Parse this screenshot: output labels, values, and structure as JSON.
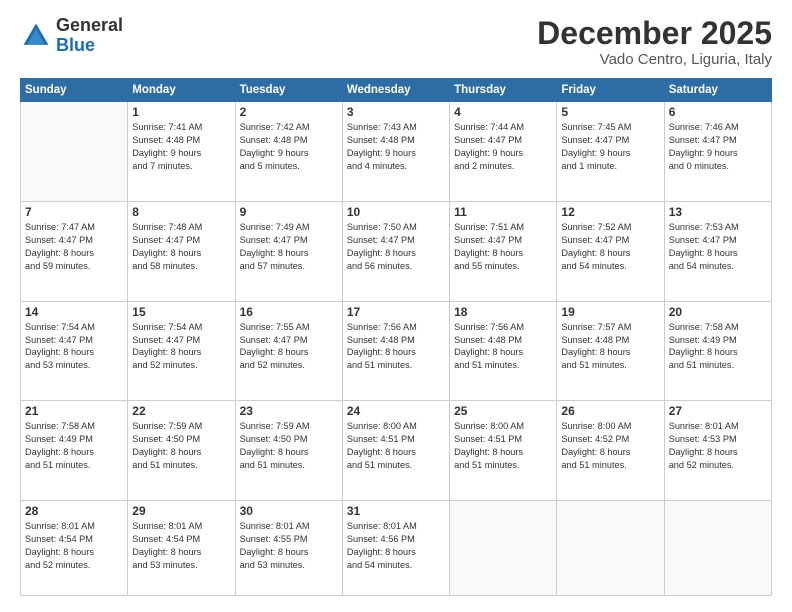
{
  "header": {
    "logo_general": "General",
    "logo_blue": "Blue",
    "month_title": "December 2025",
    "location": "Vado Centro, Liguria, Italy"
  },
  "weekdays": [
    "Sunday",
    "Monday",
    "Tuesday",
    "Wednesday",
    "Thursday",
    "Friday",
    "Saturday"
  ],
  "weeks": [
    [
      {
        "day": "",
        "info": ""
      },
      {
        "day": "1",
        "info": "Sunrise: 7:41 AM\nSunset: 4:48 PM\nDaylight: 9 hours\nand 7 minutes."
      },
      {
        "day": "2",
        "info": "Sunrise: 7:42 AM\nSunset: 4:48 PM\nDaylight: 9 hours\nand 5 minutes."
      },
      {
        "day": "3",
        "info": "Sunrise: 7:43 AM\nSunset: 4:48 PM\nDaylight: 9 hours\nand 4 minutes."
      },
      {
        "day": "4",
        "info": "Sunrise: 7:44 AM\nSunset: 4:47 PM\nDaylight: 9 hours\nand 2 minutes."
      },
      {
        "day": "5",
        "info": "Sunrise: 7:45 AM\nSunset: 4:47 PM\nDaylight: 9 hours\nand 1 minute."
      },
      {
        "day": "6",
        "info": "Sunrise: 7:46 AM\nSunset: 4:47 PM\nDaylight: 9 hours\nand 0 minutes."
      }
    ],
    [
      {
        "day": "7",
        "info": "Sunrise: 7:47 AM\nSunset: 4:47 PM\nDaylight: 8 hours\nand 59 minutes."
      },
      {
        "day": "8",
        "info": "Sunrise: 7:48 AM\nSunset: 4:47 PM\nDaylight: 8 hours\nand 58 minutes."
      },
      {
        "day": "9",
        "info": "Sunrise: 7:49 AM\nSunset: 4:47 PM\nDaylight: 8 hours\nand 57 minutes."
      },
      {
        "day": "10",
        "info": "Sunrise: 7:50 AM\nSunset: 4:47 PM\nDaylight: 8 hours\nand 56 minutes."
      },
      {
        "day": "11",
        "info": "Sunrise: 7:51 AM\nSunset: 4:47 PM\nDaylight: 8 hours\nand 55 minutes."
      },
      {
        "day": "12",
        "info": "Sunrise: 7:52 AM\nSunset: 4:47 PM\nDaylight: 8 hours\nand 54 minutes."
      },
      {
        "day": "13",
        "info": "Sunrise: 7:53 AM\nSunset: 4:47 PM\nDaylight: 8 hours\nand 54 minutes."
      }
    ],
    [
      {
        "day": "14",
        "info": "Sunrise: 7:54 AM\nSunset: 4:47 PM\nDaylight: 8 hours\nand 53 minutes."
      },
      {
        "day": "15",
        "info": "Sunrise: 7:54 AM\nSunset: 4:47 PM\nDaylight: 8 hours\nand 52 minutes."
      },
      {
        "day": "16",
        "info": "Sunrise: 7:55 AM\nSunset: 4:47 PM\nDaylight: 8 hours\nand 52 minutes."
      },
      {
        "day": "17",
        "info": "Sunrise: 7:56 AM\nSunset: 4:48 PM\nDaylight: 8 hours\nand 51 minutes."
      },
      {
        "day": "18",
        "info": "Sunrise: 7:56 AM\nSunset: 4:48 PM\nDaylight: 8 hours\nand 51 minutes."
      },
      {
        "day": "19",
        "info": "Sunrise: 7:57 AM\nSunset: 4:48 PM\nDaylight: 8 hours\nand 51 minutes."
      },
      {
        "day": "20",
        "info": "Sunrise: 7:58 AM\nSunset: 4:49 PM\nDaylight: 8 hours\nand 51 minutes."
      }
    ],
    [
      {
        "day": "21",
        "info": "Sunrise: 7:58 AM\nSunset: 4:49 PM\nDaylight: 8 hours\nand 51 minutes."
      },
      {
        "day": "22",
        "info": "Sunrise: 7:59 AM\nSunset: 4:50 PM\nDaylight: 8 hours\nand 51 minutes."
      },
      {
        "day": "23",
        "info": "Sunrise: 7:59 AM\nSunset: 4:50 PM\nDaylight: 8 hours\nand 51 minutes."
      },
      {
        "day": "24",
        "info": "Sunrise: 8:00 AM\nSunset: 4:51 PM\nDaylight: 8 hours\nand 51 minutes."
      },
      {
        "day": "25",
        "info": "Sunrise: 8:00 AM\nSunset: 4:51 PM\nDaylight: 8 hours\nand 51 minutes."
      },
      {
        "day": "26",
        "info": "Sunrise: 8:00 AM\nSunset: 4:52 PM\nDaylight: 8 hours\nand 51 minutes."
      },
      {
        "day": "27",
        "info": "Sunrise: 8:01 AM\nSunset: 4:53 PM\nDaylight: 8 hours\nand 52 minutes."
      }
    ],
    [
      {
        "day": "28",
        "info": "Sunrise: 8:01 AM\nSunset: 4:54 PM\nDaylight: 8 hours\nand 52 minutes."
      },
      {
        "day": "29",
        "info": "Sunrise: 8:01 AM\nSunset: 4:54 PM\nDaylight: 8 hours\nand 53 minutes."
      },
      {
        "day": "30",
        "info": "Sunrise: 8:01 AM\nSunset: 4:55 PM\nDaylight: 8 hours\nand 53 minutes."
      },
      {
        "day": "31",
        "info": "Sunrise: 8:01 AM\nSunset: 4:56 PM\nDaylight: 8 hours\nand 54 minutes."
      },
      {
        "day": "",
        "info": ""
      },
      {
        "day": "",
        "info": ""
      },
      {
        "day": "",
        "info": ""
      }
    ]
  ]
}
